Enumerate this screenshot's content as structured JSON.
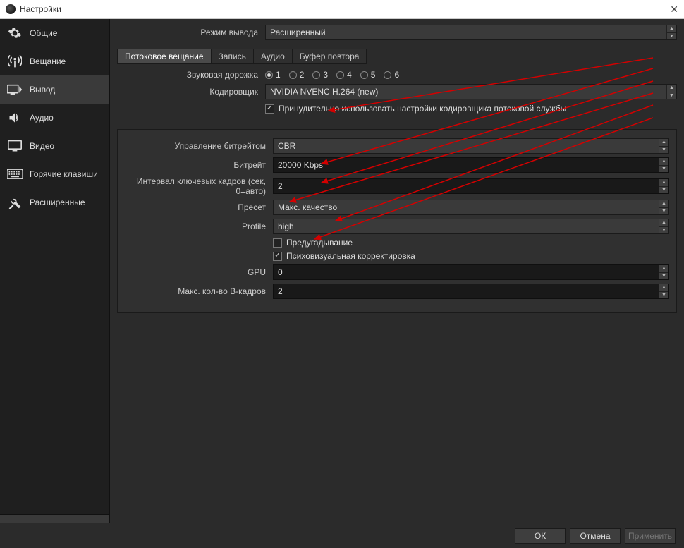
{
  "window": {
    "title": "Настройки"
  },
  "sidebar": {
    "items": [
      {
        "label": "Общие"
      },
      {
        "label": "Вещание"
      },
      {
        "label": "Вывод"
      },
      {
        "label": "Аудио"
      },
      {
        "label": "Видео"
      },
      {
        "label": "Горячие клавиши"
      },
      {
        "label": "Расширенные"
      }
    ]
  },
  "output_mode": {
    "label": "Режим вывода",
    "value": "Расширенный"
  },
  "tabs": {
    "streaming": "Потоковое вещание",
    "recording": "Запись",
    "audio": "Аудио",
    "replay": "Буфер повтора"
  },
  "audio_track": {
    "label": "Звуковая дорожка",
    "options": [
      "1",
      "2",
      "3",
      "4",
      "5",
      "6"
    ],
    "selected": "1"
  },
  "encoder": {
    "label": "Кодировщик",
    "value": "NVIDIA NVENC H.264 (new)",
    "force_label": "Принудительно использовать настройки кодировщика потоковой службы"
  },
  "settings": {
    "rate_control": {
      "label": "Управление битрейтом",
      "value": "CBR"
    },
    "bitrate": {
      "label": "Битрейт",
      "value": "20000 Kbps"
    },
    "keyint": {
      "label": "Интервал ключевых кадров (сек, 0=авто)",
      "value": "2"
    },
    "preset": {
      "label": "Пресет",
      "value": "Макс. качество"
    },
    "profile": {
      "label": "Profile",
      "value": "high"
    },
    "lookahead": {
      "label": "Предугадывание",
      "checked": false
    },
    "psycho": {
      "label": "Психовизуальная корректировка",
      "checked": true
    },
    "gpu": {
      "label": "GPU",
      "value": "0"
    },
    "bframes": {
      "label": "Макс. кол-во B-кадров",
      "value": "2"
    }
  },
  "footer": {
    "ok": "ОК",
    "cancel": "Отмена",
    "apply": "Применить"
  }
}
